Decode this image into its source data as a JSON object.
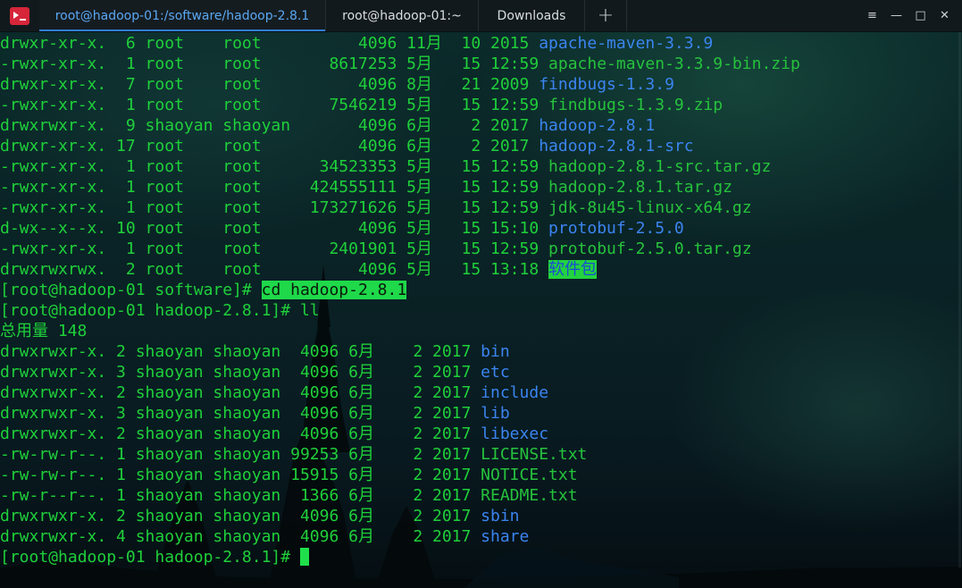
{
  "tabs": [
    {
      "label": "root@hadoop-01:/software/hadoop-2.8.1"
    },
    {
      "label": "root@hadoop-01:~"
    },
    {
      "label": "Downloads"
    }
  ],
  "window": {
    "add_tab": "+",
    "menu_icon": "≡",
    "minimize": "—",
    "maximize": "□",
    "close": "✕"
  },
  "terminal": {
    "lines": [
      {
        "text": "drwxr-xr-x.  6 root    root          4096 11月  10 2015 ",
        "name": "apache-maven-3.3.9",
        "kind": "dir"
      },
      {
        "text": "-rwxr-xr-x.  1 root    root       8617253 5月   15 12:59 ",
        "name": "apache-maven-3.3.9-bin.zip",
        "kind": "file"
      },
      {
        "text": "drwxr-xr-x.  7 root    root          4096 8月   21 2009 ",
        "name": "findbugs-1.3.9",
        "kind": "dir"
      },
      {
        "text": "-rwxr-xr-x.  1 root    root       7546219 5月   15 12:59 ",
        "name": "findbugs-1.3.9.zip",
        "kind": "file"
      },
      {
        "text": "drwxrwxr-x.  9 shaoyan shaoyan       4096 6月    2 2017 ",
        "name": "hadoop-2.8.1",
        "kind": "dir"
      },
      {
        "text": "drwxr-xr-x. 17 root    root          4096 6月    2 2017 ",
        "name": "hadoop-2.8.1-src",
        "kind": "dir"
      },
      {
        "text": "-rwxr-xr-x.  1 root    root      34523353 5月   15 12:59 ",
        "name": "hadoop-2.8.1-src.tar.gz",
        "kind": "file"
      },
      {
        "text": "-rwxr-xr-x.  1 root    root     424555111 5月   15 12:59 ",
        "name": "hadoop-2.8.1.tar.gz",
        "kind": "file"
      },
      {
        "text": "-rwxr-xr-x.  1 root    root     173271626 5月   15 12:59 ",
        "name": "jdk-8u45-linux-x64.gz",
        "kind": "file"
      },
      {
        "text": "d-wx--x--x. 10 root    root          4096 5月   15 15:10 ",
        "name": "protobuf-2.5.0",
        "kind": "dir"
      },
      {
        "text": "-rwxr-xr-x.  1 root    root       2401901 5月   15 12:59 ",
        "name": "protobuf-2.5.0.tar.gz",
        "kind": "file"
      },
      {
        "text": "drwxrwxrwx.  2 root    root          4096 5月   15 13:18 ",
        "name": "软件包",
        "kind": "hldir"
      },
      {
        "text": "[root@hadoop-01 software]# ",
        "name": "cd hadoop-2.8.1",
        "kind": "hlcmd"
      },
      {
        "text": "[root@hadoop-01 hadoop-2.8.1]# ll",
        "name": "",
        "kind": "plain"
      },
      {
        "text": "总用量 148",
        "name": "",
        "kind": "plain"
      },
      {
        "text": "drwxrwxr-x. 2 shaoyan shaoyan  4096 6月    2 2017 ",
        "name": "bin",
        "kind": "dir"
      },
      {
        "text": "drwxrwxr-x. 3 shaoyan shaoyan  4096 6月    2 2017 ",
        "name": "etc",
        "kind": "dir"
      },
      {
        "text": "drwxrwxr-x. 2 shaoyan shaoyan  4096 6月    2 2017 ",
        "name": "include",
        "kind": "dir"
      },
      {
        "text": "drwxrwxr-x. 3 shaoyan shaoyan  4096 6月    2 2017 ",
        "name": "lib",
        "kind": "dir"
      },
      {
        "text": "drwxrwxr-x. 2 shaoyan shaoyan  4096 6月    2 2017 ",
        "name": "libexec",
        "kind": "dir"
      },
      {
        "text": "-rw-rw-r--. 1 shaoyan shaoyan 99253 6月    2 2017 ",
        "name": "LICENSE.txt",
        "kind": "file"
      },
      {
        "text": "-rw-rw-r--. 1 shaoyan shaoyan 15915 6月    2 2017 ",
        "name": "NOTICE.txt",
        "kind": "file"
      },
      {
        "text": "-rw-r--r--. 1 shaoyan shaoyan  1366 6月    2 2017 ",
        "name": "README.txt",
        "kind": "file"
      },
      {
        "text": "drwxrwxr-x. 2 shaoyan shaoyan  4096 6月    2 2017 ",
        "name": "sbin",
        "kind": "dir"
      },
      {
        "text": "drwxrwxr-x. 4 shaoyan shaoyan  4096 6月    2 2017 ",
        "name": "share",
        "kind": "dir"
      },
      {
        "text": "[root@hadoop-01 hadoop-2.8.1]# ",
        "name": "",
        "kind": "cursor"
      }
    ]
  },
  "colors": {
    "accent_tab": "#5aa7f2",
    "terminal_text": "#1fd03a",
    "directory": "#3b84f0",
    "highlight": "#1fd94a"
  }
}
